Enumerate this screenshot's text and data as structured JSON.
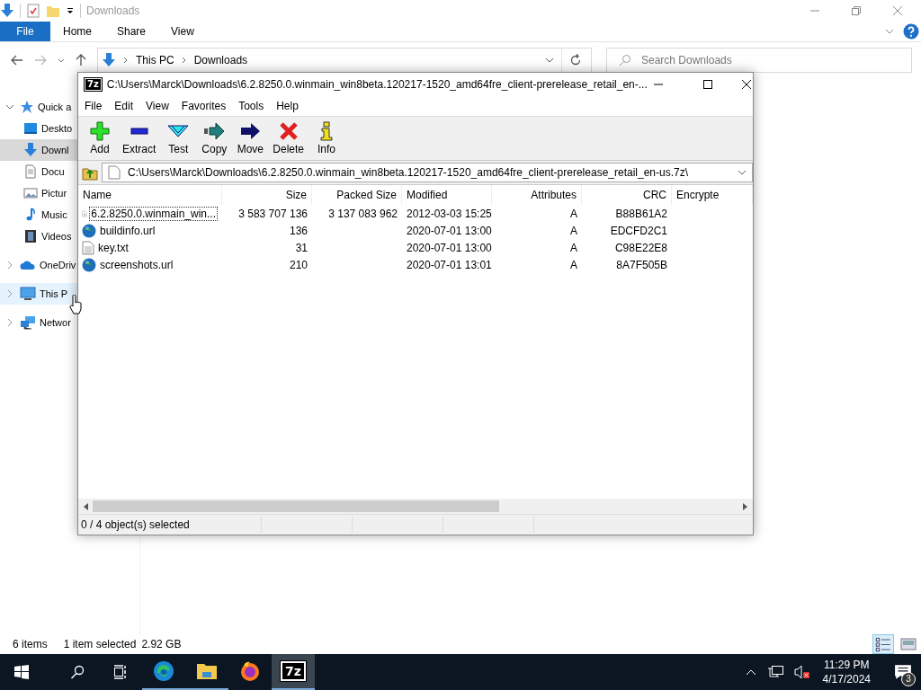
{
  "explorer": {
    "title": "Downloads",
    "ribbon": {
      "file_tab": "File",
      "tabs": [
        "Home",
        "Share",
        "View"
      ]
    },
    "address": {
      "crumbs": [
        "This PC",
        "Downloads"
      ]
    },
    "search": {
      "placeholder": "Search Downloads"
    },
    "nav": [
      {
        "label": "Quick a",
        "kind": "star",
        "expanded": true,
        "selected": false,
        "hovered": false,
        "children": [
          {
            "label": "Deskto",
            "kind": "desktop",
            "selected": false,
            "hovered": false
          },
          {
            "label": "Downl",
            "kind": "download",
            "selected": true,
            "hovered": false
          },
          {
            "label": "Docu",
            "kind": "document",
            "selected": false,
            "hovered": false
          },
          {
            "label": "Pictur",
            "kind": "picture",
            "selected": false,
            "hovered": false
          },
          {
            "label": "Music",
            "kind": "music",
            "selected": false,
            "hovered": false
          },
          {
            "label": "Videos",
            "kind": "video",
            "selected": false,
            "hovered": false
          }
        ]
      },
      {
        "label": "OneDriv",
        "kind": "cloud",
        "expanded": false,
        "selected": false,
        "hovered": false
      },
      {
        "label": "This P",
        "kind": "pc",
        "expanded": false,
        "selected": false,
        "hovered": true
      },
      {
        "label": "Networ",
        "kind": "network",
        "expanded": false,
        "selected": false,
        "hovered": false
      }
    ],
    "status": {
      "count": "6 items",
      "selection": "1 item selected",
      "size": "2.92 GB"
    }
  },
  "sevenzip": {
    "logo": "7z",
    "title": "C:\\Users\\Marck\\Downloads\\6.2.8250.0.winmain_win8beta.120217-1520_amd64fre_client-prerelease_retail_en-...",
    "menu": [
      "File",
      "Edit",
      "View",
      "Favorites",
      "Tools",
      "Help"
    ],
    "tools": [
      {
        "label": "Add",
        "kind": "add"
      },
      {
        "label": "Extract",
        "kind": "extract"
      },
      {
        "label": "Test",
        "kind": "test"
      },
      {
        "label": "Copy",
        "kind": "copy"
      },
      {
        "label": "Move",
        "kind": "move"
      },
      {
        "label": "Delete",
        "kind": "delete"
      },
      {
        "label": "Info",
        "kind": "info"
      }
    ],
    "path": "C:\\Users\\Marck\\Downloads\\6.2.8250.0.winmain_win8beta.120217-1520_amd64fre_client-prerelease_retail_en-us.7z\\",
    "columns": [
      "Name",
      "Size",
      "Packed Size",
      "Modified",
      "Attributes",
      "CRC",
      "Encrypte"
    ],
    "rows": [
      {
        "kind": "disc",
        "focused": true,
        "cells": [
          "6.2.8250.0.winmain_win...",
          "3 583 707 136",
          "3 137 083 962",
          "2012-03-03 15:25",
          "A",
          "B88B61A2"
        ]
      },
      {
        "kind": "url",
        "focused": false,
        "cells": [
          "buildinfo.url",
          "136",
          "",
          "2020-07-01 13:00",
          "A",
          "EDCFD2C1"
        ]
      },
      {
        "kind": "text",
        "focused": false,
        "cells": [
          "key.txt",
          "31",
          "",
          "2020-07-01 13:00",
          "A",
          "C98E22E8"
        ]
      },
      {
        "kind": "url",
        "focused": false,
        "cells": [
          "screenshots.url",
          "210",
          "",
          "2020-07-01 13:01",
          "A",
          "8A7F505B"
        ]
      }
    ],
    "status": "0 / 4 object(s) selected"
  },
  "taskbar": {
    "apps": [
      {
        "kind": "edge",
        "running": true,
        "active": false
      },
      {
        "kind": "explorer",
        "running": true,
        "active": false
      },
      {
        "kind": "firefox",
        "running": false,
        "active": false
      },
      {
        "kind": "sevenzip",
        "running": true,
        "active": true,
        "logo": "7z"
      }
    ],
    "tray": {
      "volume_muted": true,
      "time": "11:29 PM",
      "date": "4/17/2024",
      "notifications": "3"
    }
  }
}
